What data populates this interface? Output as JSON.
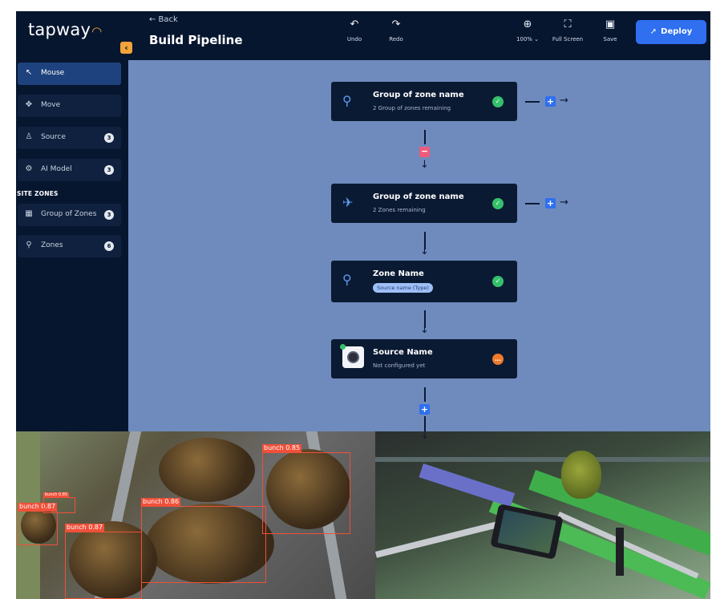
{
  "app": {
    "logo": "tapway",
    "back_label": "← Back",
    "title": "Build Pipeline"
  },
  "toolbar": {
    "undo": "Undo",
    "redo": "Redo",
    "zoom": "100% ⌄",
    "fullscreen": "Full Screen",
    "save": "Save",
    "deploy": "Deploy"
  },
  "sidebar": {
    "items": [
      {
        "label": "Mouse",
        "icon": "cursor-icon",
        "glyph": "↖",
        "badge": ""
      },
      {
        "label": "Move",
        "icon": "move-icon",
        "glyph": "✥",
        "badge": ""
      },
      {
        "label": "Source",
        "icon": "user-location-icon",
        "glyph": "♙",
        "badge": "3"
      },
      {
        "label": "AI Model",
        "icon": "chip-icon",
        "glyph": "⚙",
        "badge": "3"
      }
    ],
    "section_label": "SITE ZONES",
    "zone_items": [
      {
        "label": "Group of Zones",
        "icon": "layout-icon",
        "glyph": "▦",
        "badge": "3"
      },
      {
        "label": "Zones",
        "icon": "location-pin-icon",
        "glyph": "⚲",
        "badge": "6"
      }
    ]
  },
  "pipeline": {
    "nodes": [
      {
        "title": "Group of zone name",
        "subtitle": "2 Group of zones remaining",
        "status": "ok",
        "icon": "map-pin-stack-icon"
      },
      {
        "title": "Group of zone name",
        "subtitle": "2 Zones remaining",
        "status": "ok",
        "icon": "map-plane-icon"
      },
      {
        "title": "Zone Name",
        "pill": "Source name (Type)",
        "status": "ok",
        "icon": "map-pin-icon"
      },
      {
        "title": "Source Name",
        "subtitle": "Not configured yet",
        "status": "warn",
        "icon": "camera-icon"
      }
    ]
  },
  "photos": {
    "detections": [
      {
        "label": "bunch  0.85"
      },
      {
        "label": "bunch  0.87"
      },
      {
        "label": "bunch 0.86"
      },
      {
        "label": "bunch  0.87"
      },
      {
        "label": "bunch 0.85"
      }
    ]
  },
  "colors": {
    "bg": "#07162f",
    "canvas": "#6f8bbd",
    "accent": "#2f6ff0",
    "brand": "#f2a33a",
    "ok": "#35c06b",
    "warn": "#f07a2a",
    "remove": "#f05a7a",
    "detection": "#f0503a"
  }
}
